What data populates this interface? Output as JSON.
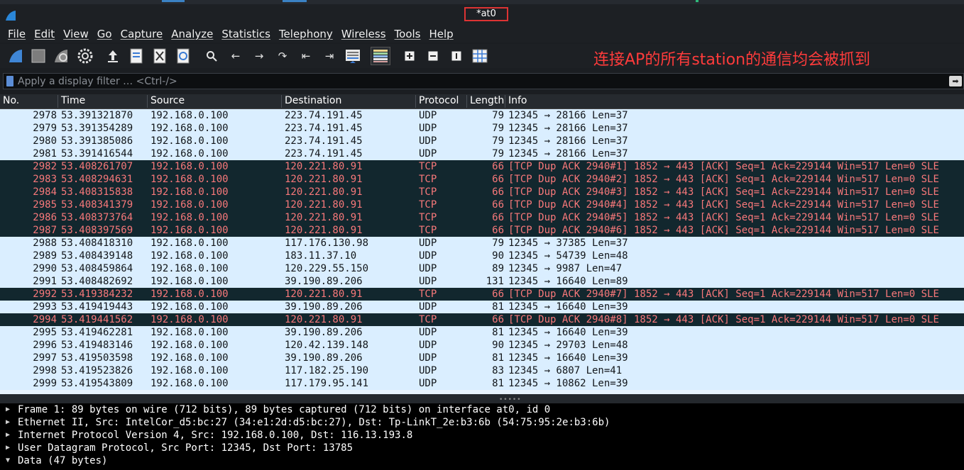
{
  "window": {
    "title": "*at0"
  },
  "menu": [
    "File",
    "Edit",
    "View",
    "Go",
    "Capture",
    "Analyze",
    "Statistics",
    "Telephony",
    "Wireless",
    "Tools",
    "Help"
  ],
  "toolbar": {
    "icons": [
      "shark-fin-start-icon",
      "stop-icon",
      "restart-icon",
      "options-gear-icon",
      "open-file-icon",
      "save-file-icon",
      "close-file-icon",
      "reload-icon",
      "find-icon",
      "back-icon",
      "forward-icon",
      "go-to-packet-icon",
      "first-packet-icon",
      "last-packet-icon",
      "auto-scroll-icon",
      "colorize-icon",
      "zoom-in-icon",
      "zoom-out-icon",
      "normal-size-icon",
      "resize-columns-icon"
    ]
  },
  "annotation": "连接AP的所有station的通信均会被抓到",
  "filter": {
    "placeholder": "Apply a display filter … <Ctrl-/>"
  },
  "columns": {
    "no": "No.",
    "time": "Time",
    "source": "Source",
    "destination": "Destination",
    "protocol": "Protocol",
    "length": "Length",
    "info": "Info"
  },
  "colors": {
    "udp_bg": "#daeeff",
    "tcp_bg": "#12272e",
    "tcp_fg": "#f7787a",
    "annotation": "#ff3b3b"
  },
  "packets": [
    {
      "no": "2978",
      "time": "53.391321870",
      "src": "192.168.0.100",
      "dst": "223.74.191.45",
      "proto": "UDP",
      "len": "79",
      "info": "12345 → 28166 Len=37"
    },
    {
      "no": "2979",
      "time": "53.391354289",
      "src": "192.168.0.100",
      "dst": "223.74.191.45",
      "proto": "UDP",
      "len": "79",
      "info": "12345 → 28166 Len=37"
    },
    {
      "no": "2980",
      "time": "53.391385086",
      "src": "192.168.0.100",
      "dst": "223.74.191.45",
      "proto": "UDP",
      "len": "79",
      "info": "12345 → 28166 Len=37"
    },
    {
      "no": "2981",
      "time": "53.391416544",
      "src": "192.168.0.100",
      "dst": "223.74.191.45",
      "proto": "UDP",
      "len": "79",
      "info": "12345 → 28166 Len=37"
    },
    {
      "no": "2982",
      "time": "53.408261707",
      "src": "192.168.0.100",
      "dst": "120.221.80.91",
      "proto": "TCP",
      "len": "66",
      "info": "[TCP Dup ACK 2940#1] 1852 → 443 [ACK] Seq=1 Ack=229144 Win=517 Len=0 SLE"
    },
    {
      "no": "2983",
      "time": "53.408294631",
      "src": "192.168.0.100",
      "dst": "120.221.80.91",
      "proto": "TCP",
      "len": "66",
      "info": "[TCP Dup ACK 2940#2] 1852 → 443 [ACK] Seq=1 Ack=229144 Win=517 Len=0 SLE"
    },
    {
      "no": "2984",
      "time": "53.408315838",
      "src": "192.168.0.100",
      "dst": "120.221.80.91",
      "proto": "TCP",
      "len": "66",
      "info": "[TCP Dup ACK 2940#3] 1852 → 443 [ACK] Seq=1 Ack=229144 Win=517 Len=0 SLE"
    },
    {
      "no": "2985",
      "time": "53.408341379",
      "src": "192.168.0.100",
      "dst": "120.221.80.91",
      "proto": "TCP",
      "len": "66",
      "info": "[TCP Dup ACK 2940#4] 1852 → 443 [ACK] Seq=1 Ack=229144 Win=517 Len=0 SLE"
    },
    {
      "no": "2986",
      "time": "53.408373764",
      "src": "192.168.0.100",
      "dst": "120.221.80.91",
      "proto": "TCP",
      "len": "66",
      "info": "[TCP Dup ACK 2940#5] 1852 → 443 [ACK] Seq=1 Ack=229144 Win=517 Len=0 SLE"
    },
    {
      "no": "2987",
      "time": "53.408397569",
      "src": "192.168.0.100",
      "dst": "120.221.80.91",
      "proto": "TCP",
      "len": "66",
      "info": "[TCP Dup ACK 2940#6] 1852 → 443 [ACK] Seq=1 Ack=229144 Win=517 Len=0 SLE"
    },
    {
      "no": "2988",
      "time": "53.408418310",
      "src": "192.168.0.100",
      "dst": "117.176.130.98",
      "proto": "UDP",
      "len": "79",
      "info": "12345 → 37385 Len=37"
    },
    {
      "no": "2989",
      "time": "53.408439148",
      "src": "192.168.0.100",
      "dst": "183.11.37.10",
      "proto": "UDP",
      "len": "90",
      "info": "12345 → 54739 Len=48"
    },
    {
      "no": "2990",
      "time": "53.408459864",
      "src": "192.168.0.100",
      "dst": "120.229.55.150",
      "proto": "UDP",
      "len": "89",
      "info": "12345 → 9987 Len=47"
    },
    {
      "no": "2991",
      "time": "53.408482692",
      "src": "192.168.0.100",
      "dst": "39.190.89.206",
      "proto": "UDP",
      "len": "131",
      "info": "12345 → 16640 Len=89"
    },
    {
      "no": "2992",
      "time": "53.419384232",
      "src": "192.168.0.100",
      "dst": "120.221.80.91",
      "proto": "TCP",
      "len": "66",
      "info": "[TCP Dup ACK 2940#7] 1852 → 443 [ACK] Seq=1 Ack=229144 Win=517 Len=0 SLE"
    },
    {
      "no": "2993",
      "time": "53.419419443",
      "src": "192.168.0.100",
      "dst": "39.190.89.206",
      "proto": "UDP",
      "len": "81",
      "info": "12345 → 16640 Len=39"
    },
    {
      "no": "2994",
      "time": "53.419441562",
      "src": "192.168.0.100",
      "dst": "120.221.80.91",
      "proto": "TCP",
      "len": "66",
      "info": "[TCP Dup ACK 2940#8] 1852 → 443 [ACK] Seq=1 Ack=229144 Win=517 Len=0 SLE"
    },
    {
      "no": "2995",
      "time": "53.419462281",
      "src": "192.168.0.100",
      "dst": "39.190.89.206",
      "proto": "UDP",
      "len": "81",
      "info": "12345 → 16640 Len=39"
    },
    {
      "no": "2996",
      "time": "53.419483146",
      "src": "192.168.0.100",
      "dst": "120.42.139.148",
      "proto": "UDP",
      "len": "90",
      "info": "12345 → 29703 Len=48"
    },
    {
      "no": "2997",
      "time": "53.419503598",
      "src": "192.168.0.100",
      "dst": "39.190.89.206",
      "proto": "UDP",
      "len": "81",
      "info": "12345 → 16640 Len=39"
    },
    {
      "no": "2998",
      "time": "53.419523826",
      "src": "192.168.0.100",
      "dst": "117.182.25.190",
      "proto": "UDP",
      "len": "83",
      "info": "12345 → 6807 Len=41"
    },
    {
      "no": "2999",
      "time": "53.419543809",
      "src": "192.168.0.100",
      "dst": "117.179.95.141",
      "proto": "UDP",
      "len": "81",
      "info": "12345 → 10862 Len=39"
    }
  ],
  "details": [
    {
      "text": "Frame 1: 89 bytes on wire (712 bits), 89 bytes captured (712 bits) on interface at0, id 0",
      "expanded": false
    },
    {
      "text": "Ethernet II, Src: IntelCor_d5:bc:27 (34:e1:2d:d5:bc:27), Dst: Tp-LinkT_2e:b3:6b (54:75:95:2e:b3:6b)",
      "expanded": false
    },
    {
      "text": "Internet Protocol Version 4, Src: 192.168.0.100, Dst: 116.13.193.8",
      "expanded": false
    },
    {
      "text": "User Datagram Protocol, Src Port: 12345, Dst Port: 13785",
      "expanded": false
    },
    {
      "text": "Data (47 bytes)",
      "expanded": true
    }
  ]
}
